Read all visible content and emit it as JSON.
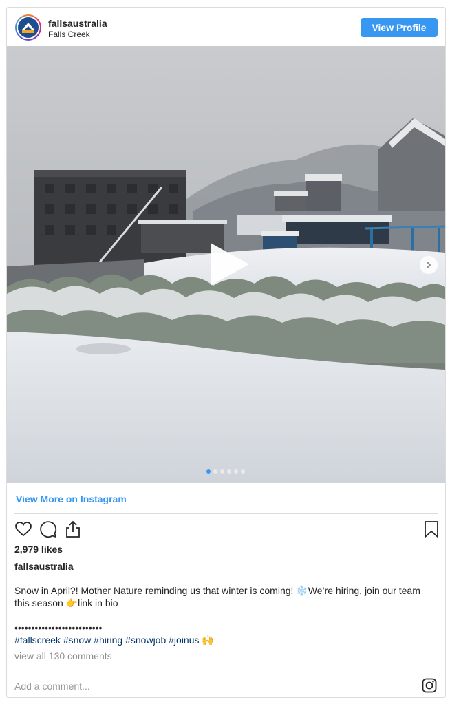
{
  "header": {
    "username": "fallsaustralia",
    "location": "Falls Creek",
    "view_profile_label": "View Profile",
    "avatar_icon": "falls-creek-logo-icon"
  },
  "media": {
    "type": "video",
    "description_icon": "play-icon",
    "carousel_count": 6,
    "carousel_active_index": 0
  },
  "view_more_label": "View More on Instagram",
  "actions": {
    "like_icon": "heart-icon",
    "comment_icon": "comment-icon",
    "share_icon": "share-icon",
    "save_icon": "bookmark-icon"
  },
  "likes_text": "2,979 likes",
  "post_username": "fallsaustralia",
  "caption": {
    "text": "Snow in April?! Mother Nature reminding us that winter is coming! ❄️We’re hiring, join our team this season 👉link in bio",
    "dots": "••••••••••••••••••••••••••",
    "hashtags": [
      "#fallscreek",
      "#snow",
      "#hiring",
      "#snowjob",
      "#joinus"
    ],
    "emoji_end": "🙌"
  },
  "comments_link": "view all 130 comments",
  "comment_placeholder": "Add a comment...",
  "colors": {
    "accent": "#3897f0",
    "hashtag": "#003569",
    "muted": "#8e8e8e"
  }
}
